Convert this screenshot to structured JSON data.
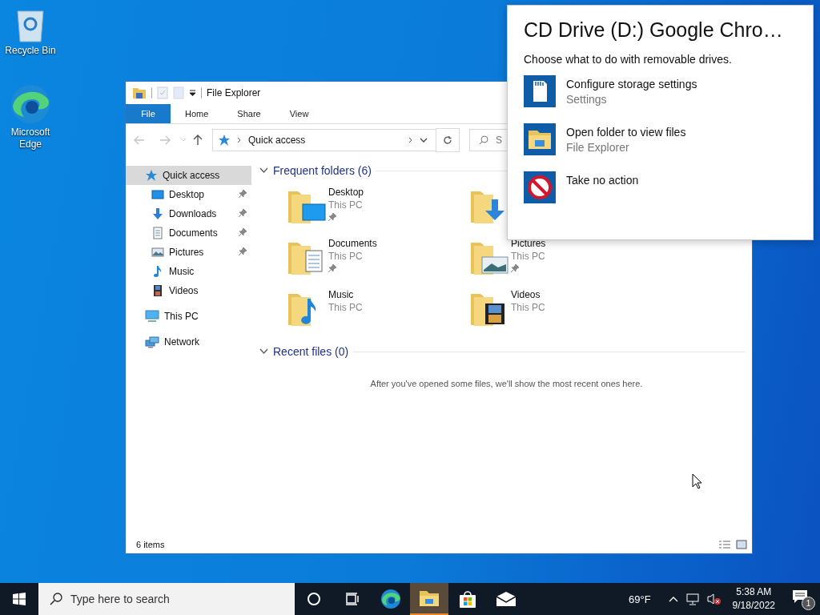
{
  "desktop_icons": [
    {
      "kind": "recycle",
      "label": "Recycle Bin"
    },
    {
      "kind": "edge",
      "label": "Microsoft Edge"
    }
  ],
  "explorer": {
    "title": "File Explorer",
    "ribbon_tabs": [
      {
        "label": "File",
        "selected": true
      },
      {
        "label": "Home",
        "selected": false
      },
      {
        "label": "Share",
        "selected": false
      },
      {
        "label": "View",
        "selected": false
      }
    ],
    "address": "Quick access",
    "search_placeholder": "S",
    "nav": [
      {
        "label": "Quick access",
        "kind": "star",
        "selected": true,
        "children": [
          {
            "label": "Desktop",
            "kind": "desktop",
            "pinned": true,
            "selected": false
          },
          {
            "label": "Downloads",
            "kind": "download",
            "pinned": true,
            "selected": false
          },
          {
            "label": "Documents",
            "kind": "document",
            "pinned": true,
            "selected": false
          },
          {
            "label": "Pictures",
            "kind": "picture",
            "pinned": true,
            "selected": false
          },
          {
            "label": "Music",
            "kind": "music",
            "pinned": false,
            "selected": false
          },
          {
            "label": "Videos",
            "kind": "video",
            "pinned": false,
            "selected": false
          }
        ]
      },
      {
        "label": "This PC",
        "kind": "pc",
        "selected": false
      },
      {
        "label": "Network",
        "kind": "network",
        "selected": false
      }
    ],
    "frequent": {
      "title": "Frequent folders (6)",
      "expanded": true,
      "folders": [
        {
          "kind": "desktop",
          "name": "Desktop",
          "location": "This PC",
          "pinned": true
        },
        {
          "kind": "download"
        },
        {
          "kind": "document",
          "name": "Documents",
          "location": "This PC",
          "pinned": true
        },
        {
          "kind": "picture",
          "name": "Pictures",
          "location": "This PC",
          "pinned": true
        },
        {
          "kind": "music",
          "name": "Music",
          "location": "This PC",
          "pinned": false
        },
        {
          "kind": "video",
          "name": "Videos",
          "location": "This PC",
          "pinned": false
        }
      ]
    },
    "recent": {
      "title": "Recent files (0)",
      "expanded": true,
      "empty_text": "After you've opened some files, we'll show the most recent ones here."
    },
    "status": "6 items"
  },
  "autoplay": {
    "title": "CD Drive (D:) Google Chro…",
    "prompt": "Choose what to do with removable drives.",
    "options": [
      {
        "kind": "storage",
        "label": "Configure storage settings",
        "sub": "Settings"
      },
      {
        "kind": "folder",
        "label": "Open folder to view files",
        "sub": "File Explorer"
      },
      {
        "kind": "block",
        "label": "Take no action"
      }
    ]
  },
  "taskbar": {
    "search_placeholder": "Type here to search",
    "apps": [
      {
        "kind": "cortana",
        "active": false
      },
      {
        "kind": "taskview",
        "active": false
      },
      {
        "kind": "edge",
        "active": false
      },
      {
        "kind": "explorer",
        "active": true
      },
      {
        "kind": "store",
        "active": false
      },
      {
        "kind": "mail",
        "active": false
      }
    ],
    "weather": "69°F",
    "time": "5:38 AM",
    "date": "9/18/2022",
    "notifications": "1"
  }
}
